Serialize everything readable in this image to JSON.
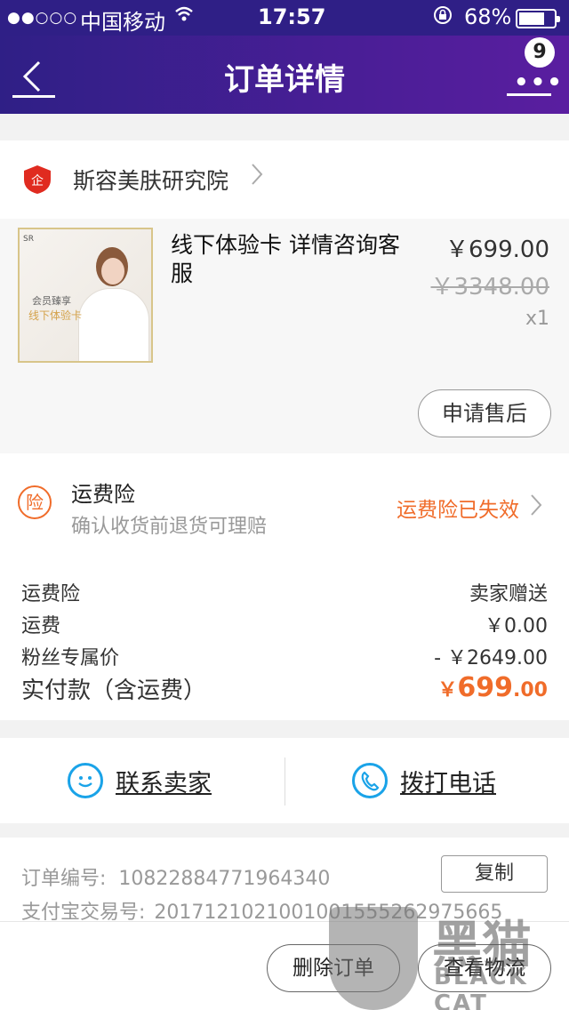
{
  "status_bar": {
    "signal": "●●○○○",
    "carrier": "中国移动",
    "wifi": "wifi-icon",
    "time": "17:57",
    "lock": "orientation-lock-icon",
    "battery_pct": "68%",
    "battery_level": 0.68
  },
  "nav": {
    "title": "订单详情",
    "badge_count": "9"
  },
  "shop": {
    "name": "斯容美肤研究院"
  },
  "product": {
    "title": "线下体验卡 详情咨询客服",
    "price": "￥699.00",
    "original_price": "￥3348.00",
    "quantity": "x1",
    "thumb_text1": "会员臻享",
    "thumb_text2": "线下体验卡",
    "after_sale_label": "申请售后"
  },
  "insurance": {
    "icon_char": "险",
    "title": "运费险",
    "subtitle": "确认收货前退货可理赔",
    "status": "运费险已失效"
  },
  "fees": [
    {
      "label": "运费险",
      "value": "卖家赠送"
    },
    {
      "label": "运费",
      "value": "￥0.00"
    },
    {
      "label": "粉丝专属价",
      "value": "- ￥2649.00"
    }
  ],
  "total": {
    "label": "实付款（含运费）",
    "currency": "￥",
    "integer": "699",
    "decimal": ".00"
  },
  "contact": {
    "seller_label": "联系卖家",
    "call_label": "拨打电话"
  },
  "order": {
    "number_label": "订单编号:",
    "number": "10822884771964340",
    "copy_label": "复制",
    "alipay_label": "支付宝交易号:",
    "alipay_number": "2017121021001001555262975665",
    "delete_label": "删除订单",
    "logistics_label": "查看物流"
  },
  "watermark": {
    "cn": "黑猫",
    "en": "BLACK CAT"
  },
  "colors": {
    "nav": "#2f1f86",
    "accent": "#f06c2a",
    "link_icon": "#1aa3e8"
  }
}
